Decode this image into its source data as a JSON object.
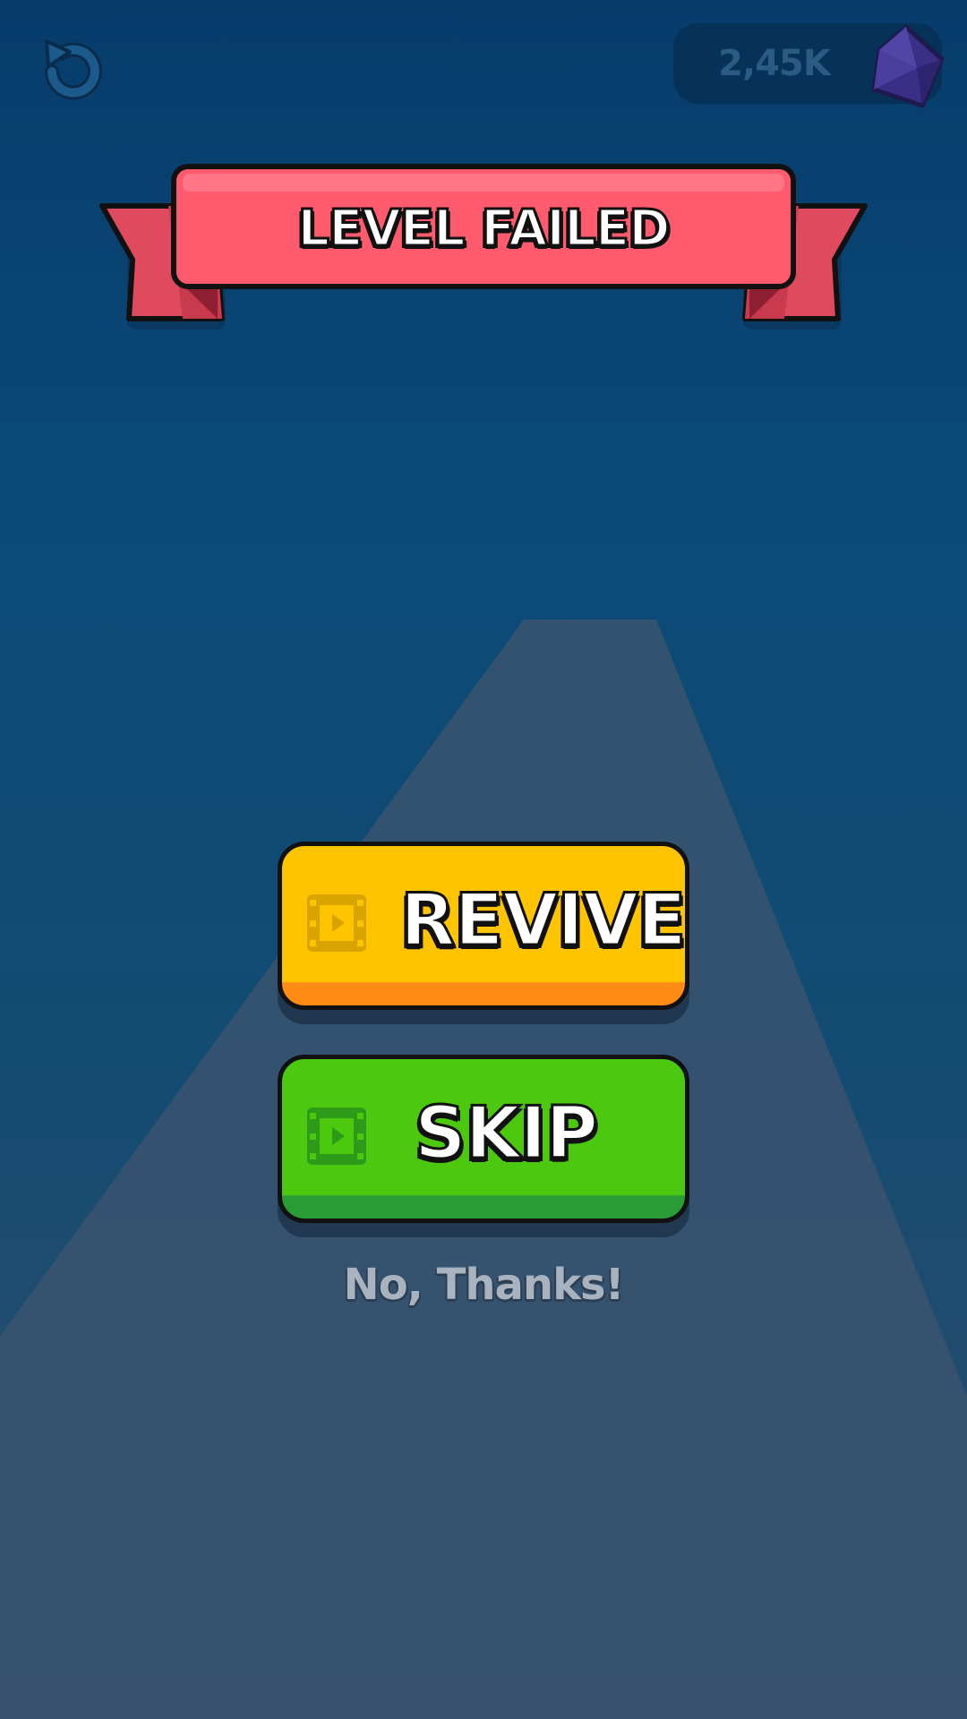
{
  "hud": {
    "restart_icon": "restart-icon",
    "currency_amount": "2,45K",
    "currency_icon": "gem-icon"
  },
  "banner": {
    "title": "LEVEL FAILED"
  },
  "actions": {
    "revive_label": "REVIVE",
    "revive_icon": "film-ad-icon",
    "skip_label": "SKIP",
    "skip_icon": "film-ad-icon",
    "decline_label": "No, Thanks!"
  },
  "colors": {
    "background": "#0b4a78",
    "banner": "#ff5a6e",
    "revive_button": "#ffc400",
    "skip_button": "#4cc90f",
    "decline_text": "#a9b3c0"
  }
}
